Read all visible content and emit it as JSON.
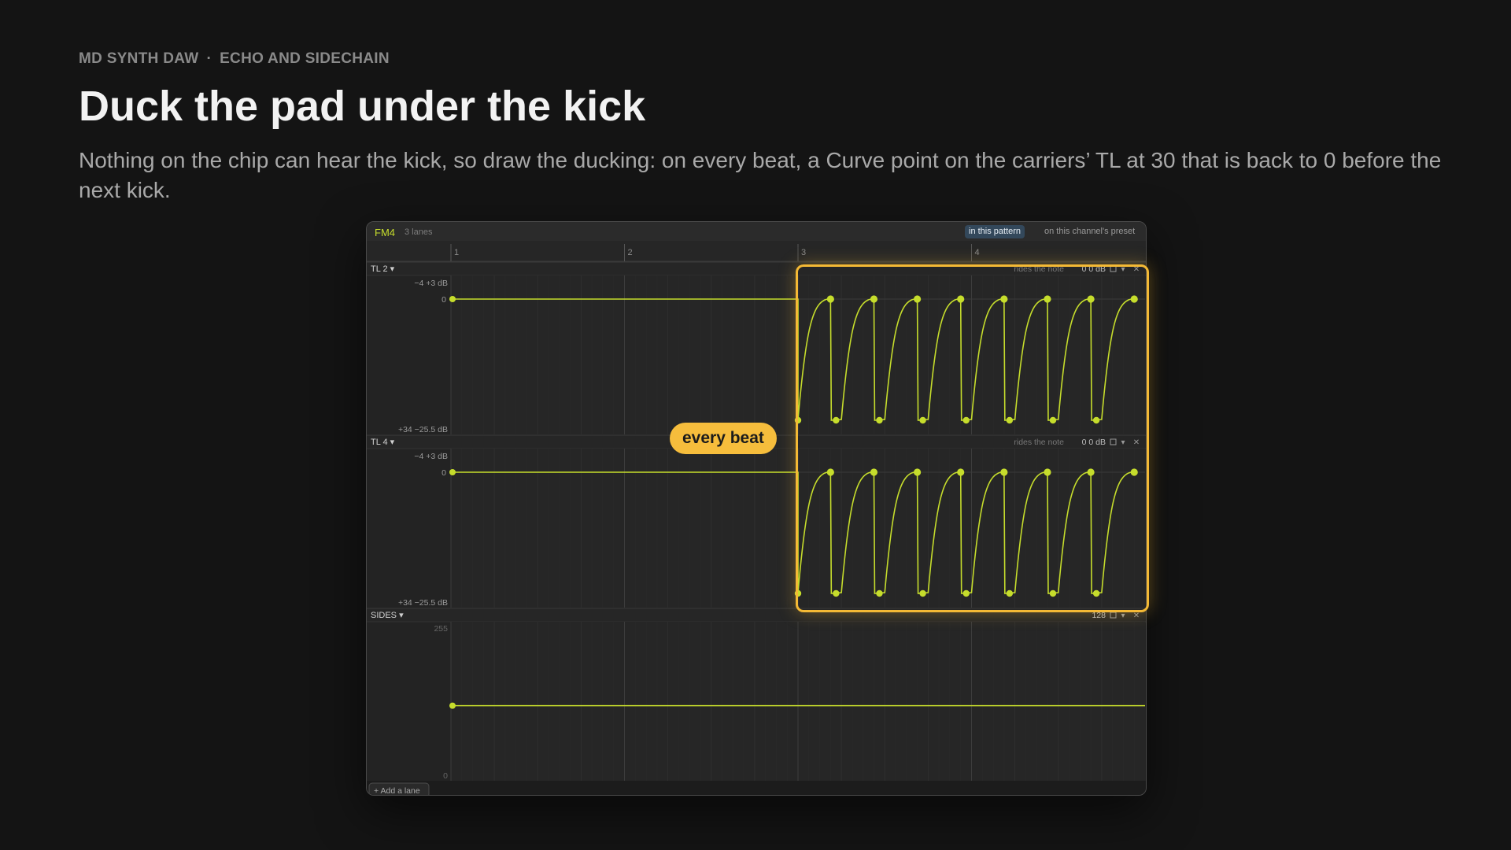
{
  "header": {
    "breadcrumb_app": "MD SYNTH DAW",
    "breadcrumb_sep": "·",
    "breadcrumb_section": "ECHO AND SIDECHAIN",
    "title": "Duck the pad under the kick",
    "description": "Nothing on the chip can hear the kick, so draw the ducking: on every beat, a Curve point on the carriers’ TL at 30 that is back to 0 before the next kick."
  },
  "window": {
    "channel": "FM4",
    "lane_count": "3 lanes",
    "scope_options": [
      "in this pattern",
      "on this channel's preset"
    ],
    "scope_selected": "in this pattern",
    "bar_numbers": [
      "1",
      "2",
      "3",
      "4"
    ],
    "add_lane_label": "+ Add a lane",
    "lanes": [
      {
        "name": "TL 2",
        "top_labels": "−4  +3 dB",
        "zero_label": "0",
        "bottom_labels": "+34  −25.5 dB",
        "mode": "rides the note",
        "value": "0  0 dB",
        "ducking": {
          "from_bar": 3,
          "beats": 8,
          "dip_value": 30,
          "rest_value": 0
        }
      },
      {
        "name": "TL 4",
        "top_labels": "−4  +3 dB",
        "zero_label": "0",
        "bottom_labels": "+34  −25.5 dB",
        "mode": "rides the note",
        "value": "0  0 dB",
        "ducking": {
          "from_bar": 3,
          "beats": 8,
          "dip_value": 30,
          "rest_value": 0
        }
      },
      {
        "name": "SIDES",
        "top_label": "255",
        "bottom_label": "0",
        "value": "128",
        "level": 128
      }
    ]
  },
  "callout": {
    "text": "every beat"
  },
  "colors": {
    "background": "#141414",
    "automation_line": "#c6dd2c",
    "highlight": "#f4b935",
    "selected_scope": "#33485b"
  }
}
